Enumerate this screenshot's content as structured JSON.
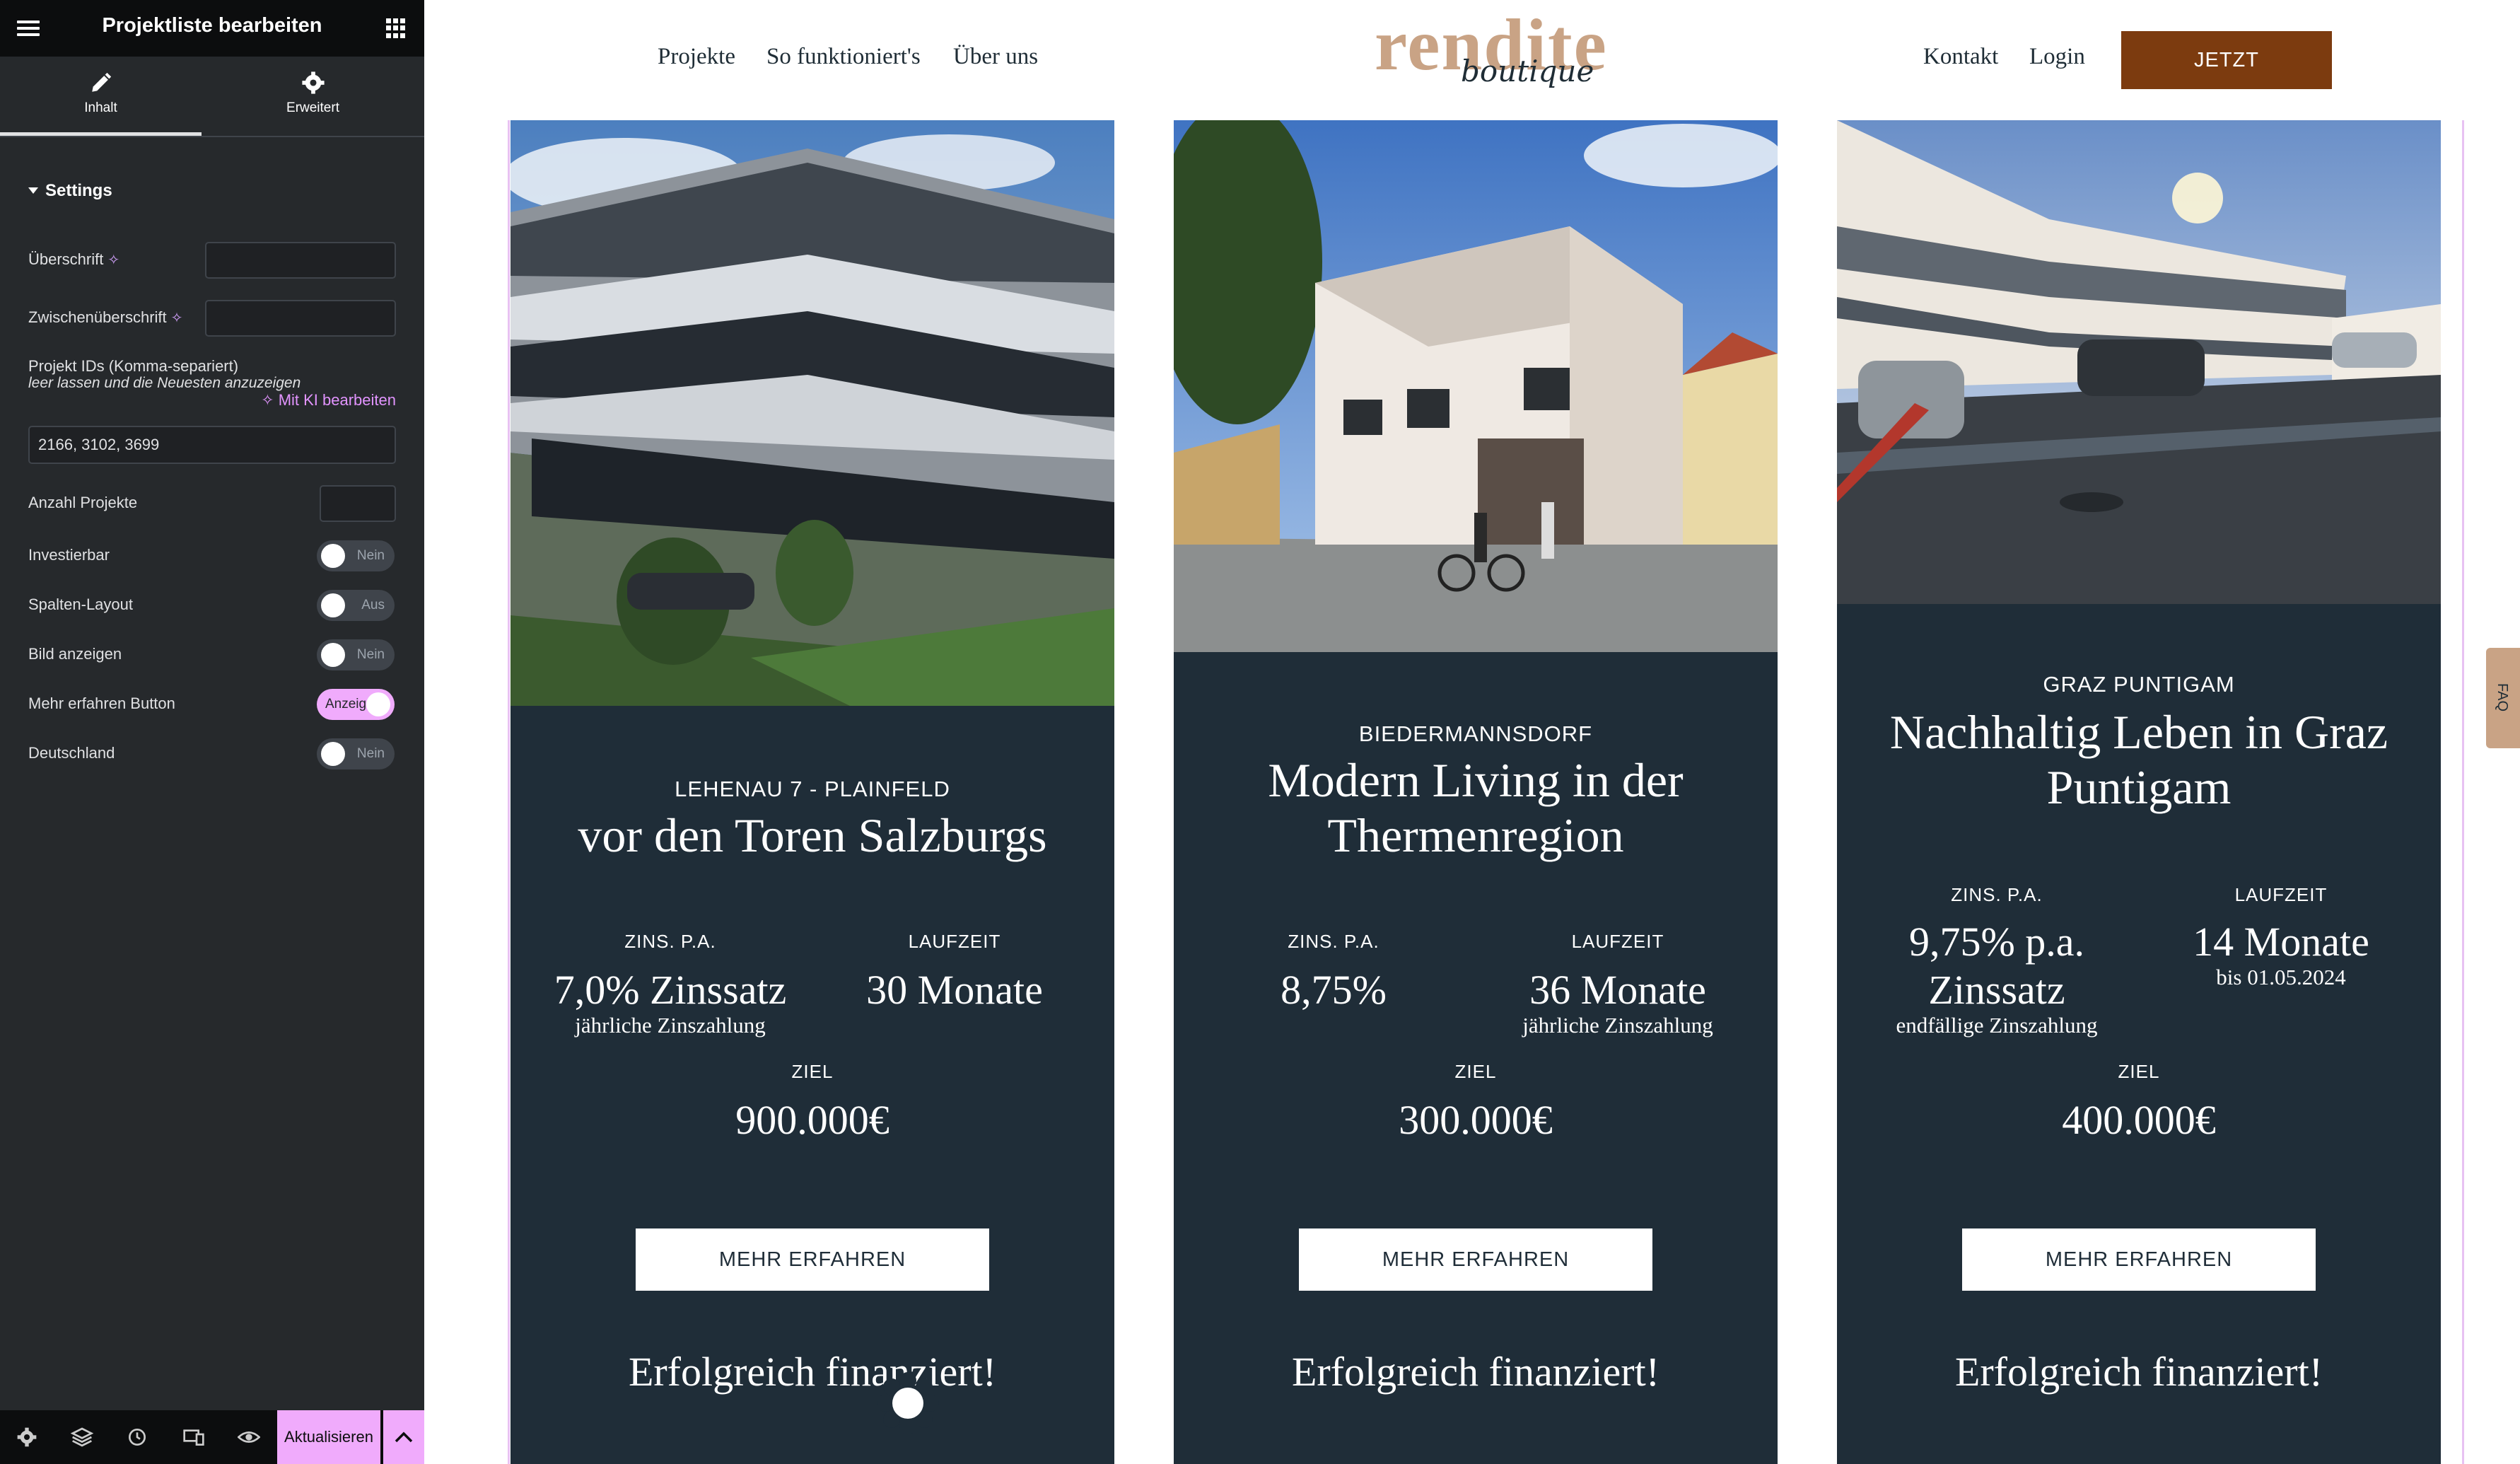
{
  "panel": {
    "title": "Projektliste bearbeiten",
    "tabs": [
      {
        "label": "Inhalt",
        "icon": "pencil-icon"
      },
      {
        "label": "Erweitert",
        "icon": "gear-icon"
      }
    ],
    "section": "Settings",
    "fields": {
      "heading_label": "Überschrift",
      "heading_value": "",
      "subheading_label": "Zwischenüberschrift",
      "subheading_value": "",
      "project_ids_label": "Projekt IDs (Komma-separiert)",
      "project_ids_hint": "leer lassen und die Neuesten anzuzeigen",
      "ki_link": "Mit KI bearbeiten",
      "project_ids_value": "2166, 3102, 3699",
      "count_label": "Anzahl Projekte",
      "count_value": ""
    },
    "toggles": [
      {
        "label": "Investierbar",
        "state": "Nein",
        "on": false
      },
      {
        "label": "Spalten-Layout",
        "state": "Aus",
        "on": false
      },
      {
        "label": "Bild anzeigen",
        "state": "Nein",
        "on": false
      },
      {
        "label": "Mehr erfahren Button",
        "state": "Anzeig",
        "on": true
      },
      {
        "label": "Deutschland",
        "state": "Nein",
        "on": false
      }
    ],
    "footer": {
      "update_label": "Aktualisieren",
      "icons": [
        "gear-icon",
        "layers-icon",
        "history-icon",
        "responsive-icon",
        "eye-icon"
      ]
    },
    "collapse_glyph": "‹"
  },
  "site": {
    "nav_left": [
      "Projekte",
      "So funktioniert's",
      "Über uns"
    ],
    "logo_main": "rendite",
    "logo_sub": "boutique",
    "nav_right": [
      "Kontakt",
      "Login"
    ],
    "cta": "JETZT INVESTIEREN",
    "faq": "FAQ",
    "colors": {
      "card": "#1f2d38",
      "cta": "#7c3b0f",
      "logo": "#c9a385",
      "accent": "#f0abfc"
    },
    "cards": [
      {
        "location": "LEHENAU 7 - PLAINFELD",
        "title": "vor den Toren Salzburgs",
        "interest_label": "ZINS. P.A.",
        "interest_value": "7,0% Zinssatz",
        "interest_sub": "jährliche Zinszahlung",
        "term_label": "LAUFZEIT",
        "term_value": "30 Monate",
        "term_sub": "",
        "goal_label": "ZIEL",
        "goal_value": "900.000€",
        "button": "MEHR ERFAHREN",
        "status": "Erfolgreich finanziert!"
      },
      {
        "location": "BIEDERMANNSDORF",
        "title": "Modern Living in der Thermenregion",
        "interest_label": "ZINS. P.A.",
        "interest_value": "8,75%",
        "interest_sub": "",
        "term_label": "LAUFZEIT",
        "term_value": "36 Monate",
        "term_sub": "jährliche Zinszahlung",
        "goal_label": "ZIEL",
        "goal_value": "300.000€",
        "button": "MEHR ERFAHREN",
        "status": "Erfolgreich finanziert!"
      },
      {
        "location": "GRAZ PUNTIGAM",
        "title": "Nachhaltig Leben in Graz Puntigam",
        "interest_label": "ZINS. P.A.",
        "interest_value": "9,75% p.a. Zinssatz",
        "interest_sub": "endfällige Zinszahlung",
        "term_label": "LAUFZEIT",
        "term_value": "14 Monate",
        "term_sub": "bis 01.05.2024",
        "goal_label": "ZIEL",
        "goal_value": "400.000€",
        "button": "MEHR ERFAHREN",
        "status": "Erfolgreich finanziert!"
      }
    ]
  }
}
